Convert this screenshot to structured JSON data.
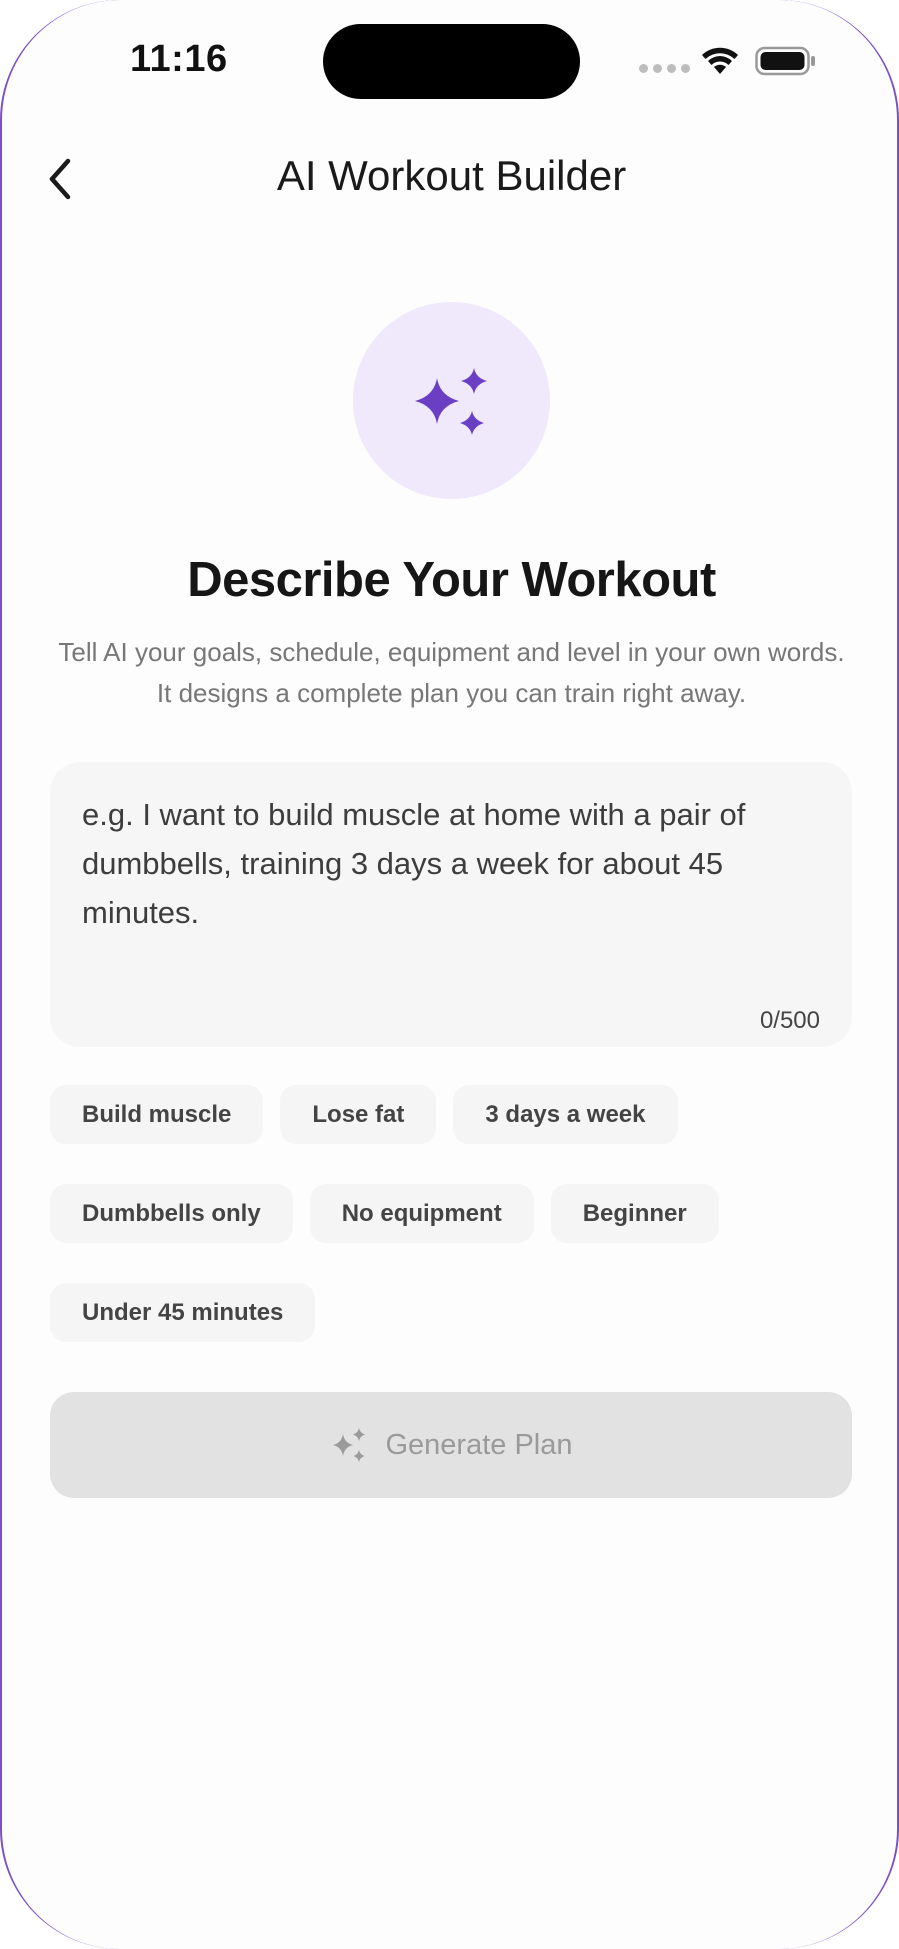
{
  "status_bar": {
    "time": "11:16"
  },
  "header": {
    "title": "AI Workout Builder",
    "back_icon": "chevron-left-icon"
  },
  "hero": {
    "icon": "sparkles-icon",
    "heading": "Describe Your Workout",
    "subtitle": "Tell AI your goals, schedule, equipment and level in your own words. It designs a complete plan you can train right away."
  },
  "prompt": {
    "value": "",
    "placeholder": "e.g. I want to build muscle at home with a pair of dumbbells, training 3 days a week for about 45 minutes.",
    "char_count": "0/500"
  },
  "suggestions": [
    [
      "Build muscle",
      "Lose fat",
      "3 days a week"
    ],
    [
      "Dumbbells only",
      "No equipment",
      "Beginner"
    ],
    [
      "Under 45 minutes"
    ]
  ],
  "generate": {
    "label": "Generate Plan",
    "icon": "sparkles-icon",
    "enabled": false
  },
  "colors": {
    "accent": "#6a3fc4",
    "accent_light": "#efe9fb",
    "disabled_bg": "#e2e2e2",
    "disabled_text": "#9a9a9a"
  }
}
